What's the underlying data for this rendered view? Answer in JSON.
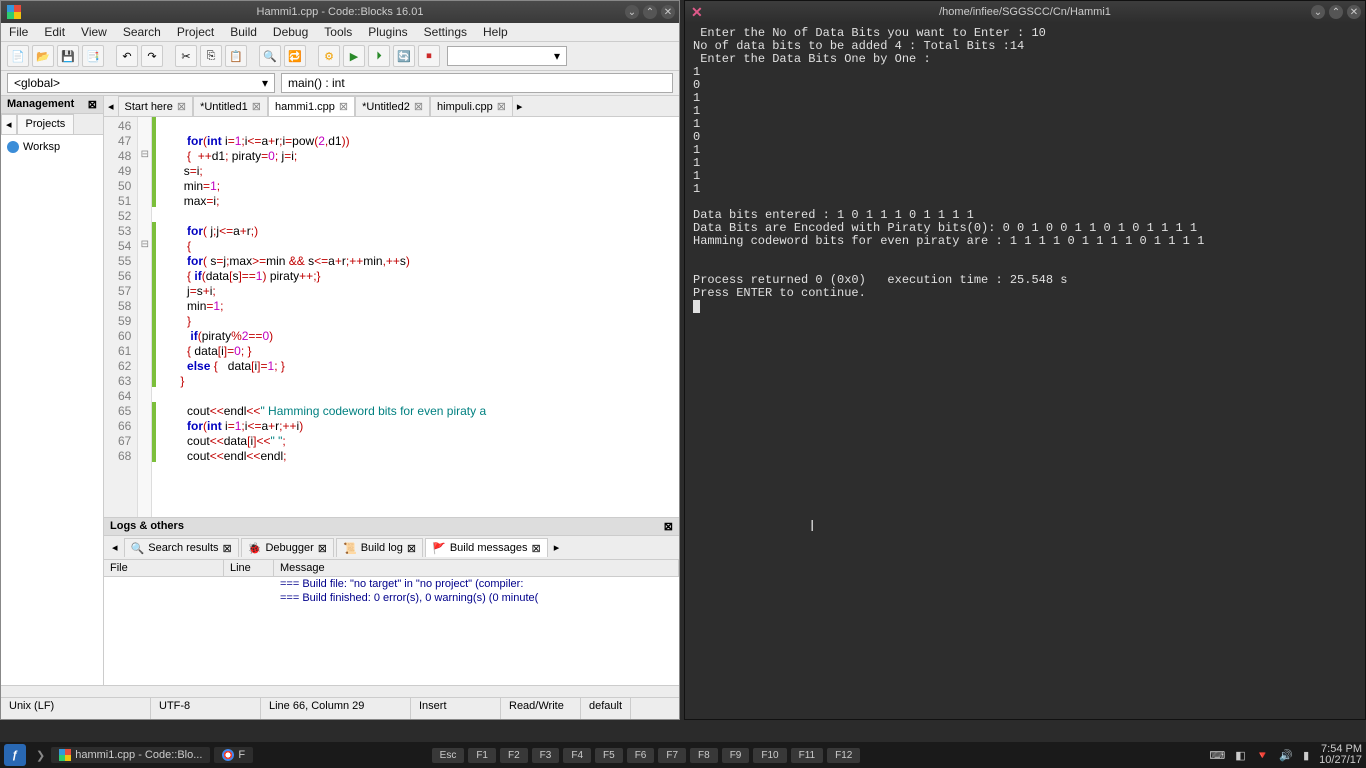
{
  "codeblocks": {
    "title": "Hammi1.cpp - Code::Blocks 16.01",
    "menubar": [
      "File",
      "Edit",
      "View",
      "Search",
      "Project",
      "Build",
      "Debug",
      "Tools",
      "Plugins",
      "Settings",
      "Help"
    ],
    "scope_dropdown": "<global>",
    "function_dropdown": "main() : int",
    "management_title": "Management",
    "management_tab": "Projects",
    "workspace_label": "Worksp",
    "editor_tabs": [
      {
        "label": "Start here",
        "active": false
      },
      {
        "label": "*Untitled1",
        "active": false
      },
      {
        "label": "hammi1.cpp",
        "active": true
      },
      {
        "label": "*Untitled2",
        "active": false
      },
      {
        "label": "himpuli.cpp",
        "active": false
      }
    ],
    "code_lines": [
      {
        "n": 46,
        "fold": "",
        "c": true,
        "tokens": []
      },
      {
        "n": 47,
        "fold": "",
        "c": true,
        "tokens": [
          [
            "sp",
            "        "
          ],
          [
            "kw",
            "for"
          ],
          [
            "op",
            "("
          ],
          [
            "kw",
            "int"
          ],
          [
            "id",
            " i"
          ],
          [
            "op",
            "="
          ],
          [
            "num",
            "1"
          ],
          [
            "op",
            ";"
          ],
          [
            "id",
            "i"
          ],
          [
            "op",
            "<="
          ],
          [
            "id",
            "a"
          ],
          [
            "op",
            "+"
          ],
          [
            "id",
            "r"
          ],
          [
            "op",
            ";"
          ],
          [
            "id",
            "i"
          ],
          [
            "op",
            "="
          ],
          [
            "id",
            "pow"
          ],
          [
            "op",
            "("
          ],
          [
            "num",
            "2"
          ],
          [
            "op",
            ","
          ],
          [
            "id",
            "d1"
          ],
          [
            "op",
            "))"
          ]
        ]
      },
      {
        "n": 48,
        "fold": "⊟",
        "c": true,
        "tokens": [
          [
            "sp",
            "        "
          ],
          [
            "op",
            "{"
          ],
          [
            "sp",
            "  "
          ],
          [
            "op",
            "++"
          ],
          [
            "id",
            "d1"
          ],
          [
            "op",
            ";"
          ],
          [
            "sp",
            " "
          ],
          [
            "id",
            "piraty"
          ],
          [
            "op",
            "="
          ],
          [
            "num",
            "0"
          ],
          [
            "op",
            ";"
          ],
          [
            "sp",
            " "
          ],
          [
            "id",
            "j"
          ],
          [
            "op",
            "="
          ],
          [
            "id",
            "i"
          ],
          [
            "op",
            ";"
          ]
        ]
      },
      {
        "n": 49,
        "fold": "",
        "c": true,
        "tokens": [
          [
            "sp",
            "       "
          ],
          [
            "id",
            "s"
          ],
          [
            "op",
            "="
          ],
          [
            "id",
            "i"
          ],
          [
            "op",
            ";"
          ]
        ]
      },
      {
        "n": 50,
        "fold": "",
        "c": true,
        "tokens": [
          [
            "sp",
            "       "
          ],
          [
            "id",
            "min"
          ],
          [
            "op",
            "="
          ],
          [
            "num",
            "1"
          ],
          [
            "op",
            ";"
          ]
        ]
      },
      {
        "n": 51,
        "fold": "",
        "c": true,
        "tokens": [
          [
            "sp",
            "       "
          ],
          [
            "id",
            "max"
          ],
          [
            "op",
            "="
          ],
          [
            "id",
            "i"
          ],
          [
            "op",
            ";"
          ]
        ]
      },
      {
        "n": 52,
        "fold": "",
        "c": false,
        "tokens": []
      },
      {
        "n": 53,
        "fold": "",
        "c": true,
        "tokens": [
          [
            "sp",
            "        "
          ],
          [
            "kw",
            "for"
          ],
          [
            "op",
            "("
          ],
          [
            "sp",
            " "
          ],
          [
            "id",
            "j"
          ],
          [
            "op",
            ";"
          ],
          [
            "id",
            "j"
          ],
          [
            "op",
            "<="
          ],
          [
            "id",
            "a"
          ],
          [
            "op",
            "+"
          ],
          [
            "id",
            "r"
          ],
          [
            "op",
            ";)"
          ]
        ]
      },
      {
        "n": 54,
        "fold": "⊟",
        "c": true,
        "tokens": [
          [
            "sp",
            "        "
          ],
          [
            "op",
            "{"
          ]
        ]
      },
      {
        "n": 55,
        "fold": "",
        "c": true,
        "tokens": [
          [
            "sp",
            "        "
          ],
          [
            "kw",
            "for"
          ],
          [
            "op",
            "("
          ],
          [
            "sp",
            " "
          ],
          [
            "id",
            "s"
          ],
          [
            "op",
            "="
          ],
          [
            "id",
            "j"
          ],
          [
            "op",
            ";"
          ],
          [
            "id",
            "max"
          ],
          [
            "op",
            ">="
          ],
          [
            "id",
            "min"
          ],
          [
            "sp",
            " "
          ],
          [
            "op",
            "&&"
          ],
          [
            "sp",
            " "
          ],
          [
            "id",
            "s"
          ],
          [
            "op",
            "<="
          ],
          [
            "id",
            "a"
          ],
          [
            "op",
            "+"
          ],
          [
            "id",
            "r"
          ],
          [
            "op",
            ";"
          ],
          [
            "op",
            "++"
          ],
          [
            "id",
            "min"
          ],
          [
            "op",
            ","
          ],
          [
            "op",
            "++"
          ],
          [
            "id",
            "s"
          ],
          [
            "op",
            ")"
          ]
        ]
      },
      {
        "n": 56,
        "fold": "",
        "c": true,
        "tokens": [
          [
            "sp",
            "        "
          ],
          [
            "op",
            "{"
          ],
          [
            "sp",
            " "
          ],
          [
            "kw",
            "if"
          ],
          [
            "op",
            "("
          ],
          [
            "id",
            "data"
          ],
          [
            "op",
            "["
          ],
          [
            "id",
            "s"
          ],
          [
            "op",
            "]"
          ],
          [
            "op",
            "=="
          ],
          [
            "num",
            "1"
          ],
          [
            "op",
            ")"
          ],
          [
            "sp",
            " "
          ],
          [
            "id",
            "piraty"
          ],
          [
            "op",
            "++;}"
          ]
        ]
      },
      {
        "n": 57,
        "fold": "",
        "c": true,
        "tokens": [
          [
            "sp",
            "        "
          ],
          [
            "id",
            "j"
          ],
          [
            "op",
            "="
          ],
          [
            "id",
            "s"
          ],
          [
            "op",
            "+"
          ],
          [
            "id",
            "i"
          ],
          [
            "op",
            ";"
          ]
        ]
      },
      {
        "n": 58,
        "fold": "",
        "c": true,
        "tokens": [
          [
            "sp",
            "        "
          ],
          [
            "id",
            "min"
          ],
          [
            "op",
            "="
          ],
          [
            "num",
            "1"
          ],
          [
            "op",
            ";"
          ]
        ]
      },
      {
        "n": 59,
        "fold": "",
        "c": true,
        "tokens": [
          [
            "sp",
            "        "
          ],
          [
            "op",
            "}"
          ]
        ]
      },
      {
        "n": 60,
        "fold": "",
        "c": true,
        "tokens": [
          [
            "sp",
            "         "
          ],
          [
            "kw",
            "if"
          ],
          [
            "op",
            "("
          ],
          [
            "id",
            "piraty"
          ],
          [
            "op",
            "%"
          ],
          [
            "num",
            "2"
          ],
          [
            "op",
            "=="
          ],
          [
            "num",
            "0"
          ],
          [
            "op",
            ")"
          ]
        ]
      },
      {
        "n": 61,
        "fold": "",
        "c": true,
        "tokens": [
          [
            "sp",
            "        "
          ],
          [
            "op",
            "{"
          ],
          [
            "sp",
            " "
          ],
          [
            "id",
            "data"
          ],
          [
            "op",
            "["
          ],
          [
            "id",
            "i"
          ],
          [
            "op",
            "]"
          ],
          [
            "op",
            "="
          ],
          [
            "num",
            "0"
          ],
          [
            "op",
            ";"
          ],
          [
            "sp",
            " "
          ],
          [
            "op",
            "}"
          ]
        ]
      },
      {
        "n": 62,
        "fold": "",
        "c": true,
        "tokens": [
          [
            "sp",
            "        "
          ],
          [
            "kw",
            "else"
          ],
          [
            "sp",
            " "
          ],
          [
            "op",
            "{"
          ],
          [
            "sp",
            "   "
          ],
          [
            "id",
            "data"
          ],
          [
            "op",
            "["
          ],
          [
            "id",
            "i"
          ],
          [
            "op",
            "]"
          ],
          [
            "op",
            "="
          ],
          [
            "num",
            "1"
          ],
          [
            "op",
            ";"
          ],
          [
            "sp",
            " "
          ],
          [
            "op",
            "}"
          ]
        ]
      },
      {
        "n": 63,
        "fold": "",
        "c": true,
        "tokens": [
          [
            "sp",
            "      "
          ],
          [
            "op",
            "}"
          ]
        ]
      },
      {
        "n": 64,
        "fold": "",
        "c": false,
        "tokens": []
      },
      {
        "n": 65,
        "fold": "",
        "c": true,
        "tokens": [
          [
            "sp",
            "        "
          ],
          [
            "id",
            "cout"
          ],
          [
            "op",
            "<<"
          ],
          [
            "id",
            "endl"
          ],
          [
            "op",
            "<<"
          ],
          [
            "str",
            "\" Hamming codeword bits for even piraty a"
          ]
        ]
      },
      {
        "n": 66,
        "fold": "",
        "c": true,
        "tokens": [
          [
            "sp",
            "        "
          ],
          [
            "kw",
            "for"
          ],
          [
            "op",
            "("
          ],
          [
            "kw",
            "int"
          ],
          [
            "sp",
            " "
          ],
          [
            "id",
            "i"
          ],
          [
            "op",
            "="
          ],
          [
            "num",
            "1"
          ],
          [
            "op",
            ";"
          ],
          [
            "id",
            "i"
          ],
          [
            "op",
            "<="
          ],
          [
            "id",
            "a"
          ],
          [
            "op",
            "+"
          ],
          [
            "id",
            "r"
          ],
          [
            "op",
            ";"
          ],
          [
            "op",
            "++"
          ],
          [
            "id",
            "i"
          ],
          [
            "op",
            ")"
          ]
        ]
      },
      {
        "n": 67,
        "fold": "",
        "c": true,
        "tokens": [
          [
            "sp",
            "        "
          ],
          [
            "id",
            "cout"
          ],
          [
            "op",
            "<<"
          ],
          [
            "id",
            "data"
          ],
          [
            "op",
            "["
          ],
          [
            "id",
            "i"
          ],
          [
            "op",
            "]"
          ],
          [
            "op",
            "<<"
          ],
          [
            "str",
            "\" \""
          ],
          [
            "op",
            ";"
          ]
        ]
      },
      {
        "n": 68,
        "fold": "",
        "c": true,
        "tokens": [
          [
            "sp",
            "        "
          ],
          [
            "id",
            "cout"
          ],
          [
            "op",
            "<<"
          ],
          [
            "id",
            "endl"
          ],
          [
            "op",
            "<<"
          ],
          [
            "id",
            "endl"
          ],
          [
            "op",
            ";"
          ]
        ]
      }
    ],
    "logs_title": "Logs & others",
    "logs_tabs": [
      {
        "label": "Search results",
        "icon": "🔍"
      },
      {
        "label": "Debugger",
        "icon": "🐞"
      },
      {
        "label": "Build log",
        "icon": "📜"
      },
      {
        "label": "Build messages",
        "icon": "🚩",
        "active": true
      }
    ],
    "log_headers": [
      "File",
      "Line",
      "Message"
    ],
    "log_rows": [
      {
        "file": "",
        "line": "",
        "msg": "=== Build file: \"no target\" in \"no project\" (compiler:"
      },
      {
        "file": "",
        "line": "",
        "msg": "=== Build finished: 0 error(s), 0 warning(s) (0 minute("
      }
    ],
    "statusbar": {
      "eol": "Unix (LF)",
      "enc": "UTF-8",
      "pos": "Line 66, Column 29",
      "mode": "Insert",
      "rw": "Read/Write",
      "def": "default"
    }
  },
  "terminal": {
    "title": "/home/infiee/SGGSCC/Cn/Hammi1",
    "lines": [
      " Enter the No of Data Bits you want to Enter : 10",
      "No of data bits to be added 4 : Total Bits :14",
      " Enter the Data Bits One by One :",
      "1",
      "0",
      "1",
      "1",
      "1",
      "0",
      "1",
      "1",
      "1",
      "1",
      "",
      "Data bits entered : 1 0 1 1 1 0 1 1 1 1",
      "Data Bits are Encoded with Piraty bits(0): 0 0 1 0 0 1 1 0 1 0 1 1 1 1",
      "Hamming codeword bits for even piraty are : 1 1 1 1 0 1 1 1 1 0 1 1 1 1",
      "",
      "",
      "Process returned 0 (0x0)   execution time : 25.548 s",
      "Press ENTER to continue."
    ]
  },
  "taskbar": {
    "tasks": [
      {
        "label": "hammi1.cpp - Code::Blo...",
        "icon": "cb"
      },
      {
        "label": "F",
        "icon": "chrome"
      }
    ],
    "fkeys": [
      "Esc",
      "F1",
      "F2",
      "F3",
      "F4",
      "F5",
      "F6",
      "F7",
      "F8",
      "F9",
      "F10",
      "F11",
      "F12"
    ],
    "time": "7:54 PM",
    "date": "10/27/17"
  }
}
